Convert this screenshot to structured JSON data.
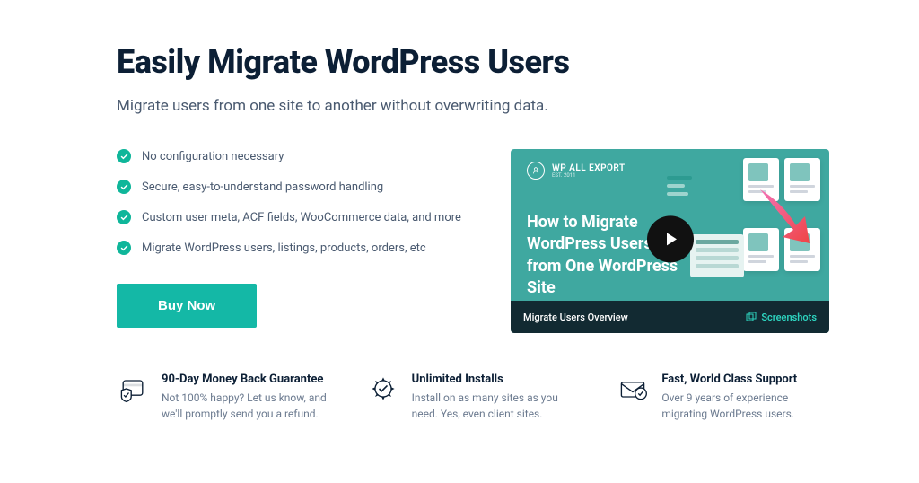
{
  "hero": {
    "title": "Easily Migrate WordPress Users",
    "subtitle": "Migrate users from one site to another without overwriting data."
  },
  "features": [
    "No configuration necessary",
    "Secure, easy-to-understand password handling",
    "Custom user meta, ACF fields, WooCommerce data, and more",
    "Migrate WordPress users, listings, products, orders, etc"
  ],
  "cta": {
    "buy": "Buy Now"
  },
  "video": {
    "brand": "WP ALL EXPORT",
    "brand_sub": "EST. 2011",
    "headline": "How to Migrate WordPress Users from One WordPress Site",
    "bar_title": "Migrate Users Overview",
    "screenshots_label": "Screenshots"
  },
  "benefits": [
    {
      "title": "90-Day Money Back Guarantee",
      "desc": "Not 100% happy? Let us know, and we'll promptly send you a refund."
    },
    {
      "title": "Unlimited Installs",
      "desc": "Install on as many sites as you need. Yes, even client sites."
    },
    {
      "title": "Fast, World Class Support",
      "desc": "Over 9 years of experience migrating WordPress users."
    }
  ]
}
